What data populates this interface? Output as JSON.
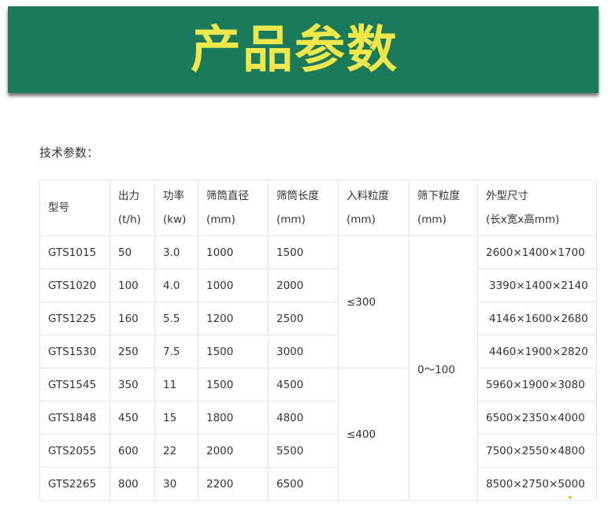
{
  "banner": {
    "title": "产品参数"
  },
  "section_label": "技术参数：",
  "table": {
    "headers": [
      {
        "line1": "型号",
        "line2": ""
      },
      {
        "line1": "出力",
        "line2": "(t/h)"
      },
      {
        "line1": "功率",
        "line2": "(kw)"
      },
      {
        "line1": "筛筒直径",
        "line2": "(mm)"
      },
      {
        "line1": "筛筒长度",
        "line2": "(mm)"
      },
      {
        "line1": "入料粒度",
        "line2": "(mm)"
      },
      {
        "line1": "筛下粒度",
        "line2": "(mm)"
      },
      {
        "line1": "外型尺寸",
        "line2": "(长x宽x高mm)"
      }
    ],
    "rows": [
      {
        "model": "GTS1015",
        "output": "50",
        "power": "3.0",
        "diameter": "1000",
        "length": "1500",
        "size": "2600×1400×1700"
      },
      {
        "model": "GTS1020",
        "output": "100",
        "power": "4.0",
        "diameter": "1000",
        "length": "2000",
        "size": "3390×1400×2140"
      },
      {
        "model": "GTS1225",
        "output": "160",
        "power": "5.5",
        "diameter": "1200",
        "length": "2500",
        "size": "4146×1600×2680"
      },
      {
        "model": "GTS1530",
        "output": "250",
        "power": "7.5",
        "diameter": "1500",
        "length": "3000",
        "size": "4460×1900×2820"
      },
      {
        "model": "GTS1545",
        "output": "350",
        "power": "11",
        "diameter": "1500",
        "length": "4500",
        "size": "5960×1900×3080"
      },
      {
        "model": "GTS1848",
        "output": "450",
        "power": "15",
        "diameter": "1800",
        "length": "4800",
        "size": "6500×2350×4000"
      },
      {
        "model": "GTS2055",
        "output": "600",
        "power": "22",
        "diameter": "2000",
        "length": "5500",
        "size": "7500×2550×4800"
      },
      {
        "model": "GTS2265",
        "output": "800",
        "power": "30",
        "diameter": "2200",
        "length": "6500",
        "size": "8500×2750×5000"
      }
    ],
    "feed_size_groups": [
      "≤300",
      "≤400"
    ],
    "undersize": "0～100"
  }
}
